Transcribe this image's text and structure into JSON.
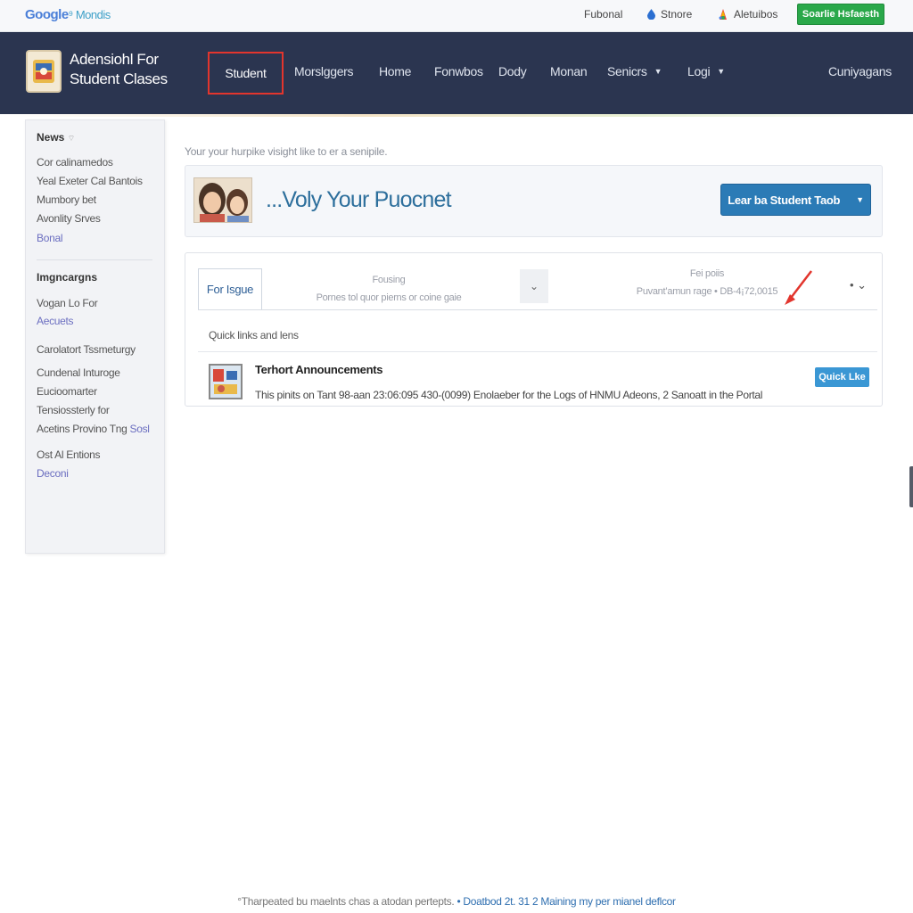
{
  "topbar": {
    "logo_primary": "Google",
    "logo_secondary": "⁹ Mondis",
    "links": [
      {
        "label": "Fubonal"
      },
      {
        "label": "Stnore"
      },
      {
        "label": "Aletuibos"
      }
    ],
    "cta_label": "Soarlie Hsfaesth"
  },
  "nav": {
    "brand": "Adensiohl For Student Clases",
    "active_item": "Student",
    "items": [
      {
        "label": "Morslggers"
      },
      {
        "label": "Home"
      },
      {
        "label": "Fonwbos"
      },
      {
        "label": "Dody"
      },
      {
        "label": "Monan"
      },
      {
        "label": "Senicrs"
      },
      {
        "label": "Logi"
      }
    ],
    "right_label": "Cuniyagans"
  },
  "sidebar": {
    "news_heading": "News",
    "news_items": [
      "Cor calinamedos",
      "Yeal Exeter Cal Bantois",
      "Mumbory bet",
      "Avonlity Srves"
    ],
    "news_link": "Bonal",
    "section2_heading": "Imgncargns",
    "section2_item1": "Vogan Lo For",
    "section2_link1": "Aecuets",
    "section2_items": [
      "Carolatort Tssmeturgy",
      "Cundenal Inturoge",
      "Eucioomarter",
      "Tensiossterly for"
    ],
    "section2_item_last": "Acetins Provino Tng",
    "section2_item_last_link": "Sosl",
    "section3_item": "Ost Al Entions",
    "section3_link": "Deconi"
  },
  "main": {
    "intro": "Your your hurpike visight like to er a senipile.",
    "hero_title": "...Voly Your Puocnet",
    "hero_button": "Lear ba Student Taob",
    "tabs": {
      "active": "For Isgue",
      "col2_line1": "Fousing",
      "col2_line2": "Pornes tol quor pierns or coine gaie",
      "col3_line1": "Fei poiis",
      "col3_line2": "Puvant’amun rage • DB-4¡72,0015"
    },
    "quick_label": "Quick links and lens",
    "announcement": {
      "title": "Terhort Announcements",
      "body": "This pinits on Tant 98-aan 23:06:095 430-(0099) Enolaeber for the Logs of HNMU Adeons, 2 Sanoatt in the Portal",
      "button": "Quick Lke"
    }
  },
  "footer": {
    "text": "°Tharpeated bu maelnts chas a atodan pertepts.",
    "link": "• Doatbod 2t. 31 2 Maining my per mianel deflcor"
  }
}
